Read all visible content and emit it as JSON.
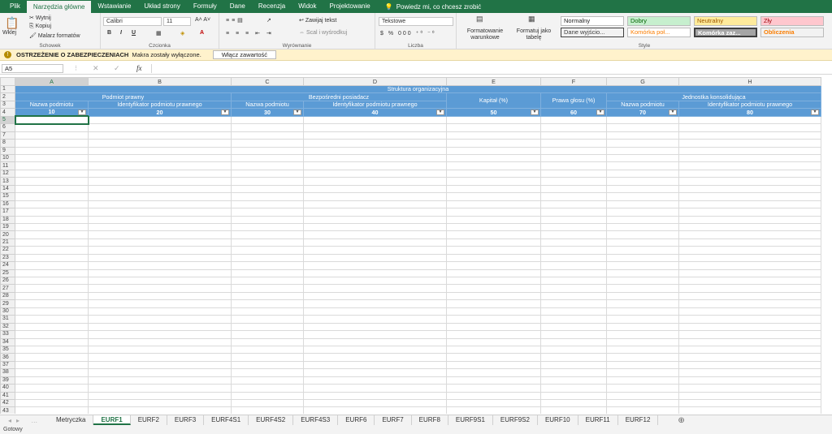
{
  "ribbon_tabs": [
    "Plik",
    "Narzędzia główne",
    "Wstawianie",
    "Układ strony",
    "Formuły",
    "Dane",
    "Recenzja",
    "Widok",
    "Projektowanie"
  ],
  "active_tab": "Narzędzia główne",
  "tell_me": "Powiedz mi, co chcesz zrobić",
  "clipboard": {
    "paste": "Wklej",
    "cut": "Wytnij",
    "copy": "Kopiuj",
    "painter": "Malarz formatów",
    "label": "Schowek"
  },
  "font": {
    "name": "Calibri",
    "size": "11",
    "label": "Czcionka"
  },
  "alignment": {
    "wrap": "Zawijaj tekst",
    "merge": "Scal i wyśrodkuj",
    "label": "Wyrównanie"
  },
  "number": {
    "format": "Tekstowe",
    "label": "Liczba"
  },
  "styles_group": {
    "cond": "Formatowanie warunkowe",
    "table": "Formatuj jako tabelę",
    "label": "Style"
  },
  "styles": [
    "Normalny",
    "Dobry",
    "Neutralny",
    "Zły",
    "Dane wyjścio...",
    "Komórka poł...",
    "Komórka zaz...",
    "Obliczenia"
  ],
  "warning": {
    "title": "OSTRZEŻENIE O ZABEZPIECZENIACH",
    "text": "Makra zostały wyłączone.",
    "button": "Włącz zawartość"
  },
  "namebox": "A5",
  "fx": "fx",
  "columns": [
    "A",
    "B",
    "C",
    "D",
    "E",
    "F",
    "G",
    "H"
  ],
  "cells": {
    "r1": "Struktura organizacyjna",
    "r2": [
      "Podmiot prawny",
      "Bezpośredni posiadacz",
      "Kapitał (%)",
      "Prawa głosu (%)",
      "Jednostka konsolidująca"
    ],
    "r3": [
      "Nazwa podmiotu",
      "Identyfikator podmiotu prawnego",
      "Nazwa podmiotu",
      "Identyfikator podmiotu prawnego",
      "Nazwa podmiotu",
      "Identyfikator podmiotu prawnego"
    ],
    "r4": [
      "10",
      "20",
      "30",
      "40",
      "50",
      "60",
      "70",
      "80"
    ]
  },
  "sheets": [
    "Metryczka",
    "EURF1",
    "EURF2",
    "EURF3",
    "EURF4S1",
    "EURF4S2",
    "EURF4S3",
    "EURF6",
    "EURF7",
    "EURF8",
    "EURF9S1",
    "EURF9S2",
    "EURF10",
    "EURF11",
    "EURF12"
  ],
  "active_sheet": "EURF1",
  "status": "Gotowy"
}
